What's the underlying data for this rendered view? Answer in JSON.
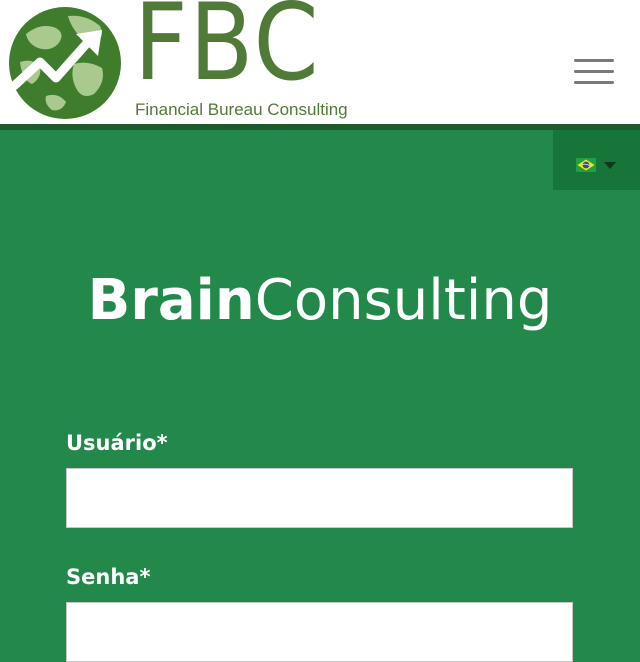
{
  "header": {
    "logo_letters": "FBC",
    "logo_tagline": "Financial Bureau Consulting",
    "menu_icon": "hamburger-menu-icon"
  },
  "language": {
    "flag": "brazil-flag-icon",
    "caret": "caret-down-icon"
  },
  "brand": {
    "bold": "Brain",
    "light": "Consulting"
  },
  "form": {
    "username_label": "Usuário*",
    "username_value": "",
    "password_label": "Senha*",
    "password_value": ""
  },
  "colors": {
    "background": "#22894b",
    "header_border": "#1f5a2b",
    "logo_green": "#4f7a37",
    "language_bg": "#17753a"
  }
}
